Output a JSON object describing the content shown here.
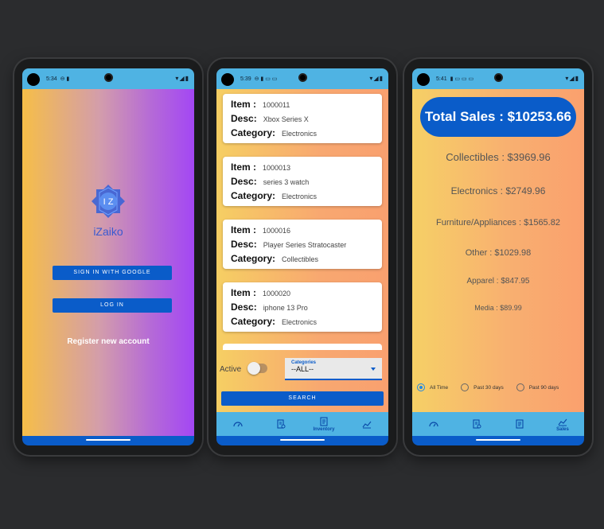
{
  "phone1": {
    "status_time": "5:34",
    "logo_text": "iZaiko",
    "sign_in_google": "SIGN IN WITH GOOGLE",
    "login": "LOG IN",
    "register": "Register new account"
  },
  "phone2": {
    "status_time": "5:39",
    "cards": [
      {
        "item_label": "Item :",
        "item": "1000011",
        "desc_label": "Desc:",
        "desc": "Xbox Series X",
        "cat_label": "Category:",
        "category": "Electronics"
      },
      {
        "item_label": "Item :",
        "item": "1000013",
        "desc_label": "Desc:",
        "desc": "series 3 watch",
        "cat_label": "Category:",
        "category": "Electronics"
      },
      {
        "item_label": "Item :",
        "item": "1000016",
        "desc_label": "Desc:",
        "desc": "Player Series Stratocaster",
        "cat_label": "Category:",
        "category": "Collectibles"
      },
      {
        "item_label": "Item :",
        "item": "1000020",
        "desc_label": "Desc:",
        "desc": "iphone 13 Pro",
        "cat_label": "Category:",
        "category": "Electronics"
      }
    ],
    "active_label": "Active",
    "select_label": "Categories",
    "select_value": "--ALL--",
    "search": "SEARCH",
    "tabs": [
      "",
      "",
      "Inventory",
      ""
    ]
  },
  "phone3": {
    "status_time": "5:41",
    "total": "Total Sales : $10253.66",
    "categories": [
      "Collectibles : $3969.96",
      "Electronics : $2749.96",
      "Furniture/Appliances : $1565.82",
      "Other : $1029.98",
      "Apparel : $847.95",
      "Media : $89.99"
    ],
    "radios": [
      "All Time",
      "Past 30 days",
      "Past 90 days"
    ],
    "tabs": [
      "",
      "",
      "",
      "Sales"
    ]
  },
  "colors": {
    "accent": "#0a5cc9",
    "bar": "#4fb3e3"
  },
  "icons": [
    "dashboard-icon",
    "receipt-icon",
    "inventory-icon",
    "sales-chart-icon"
  ]
}
